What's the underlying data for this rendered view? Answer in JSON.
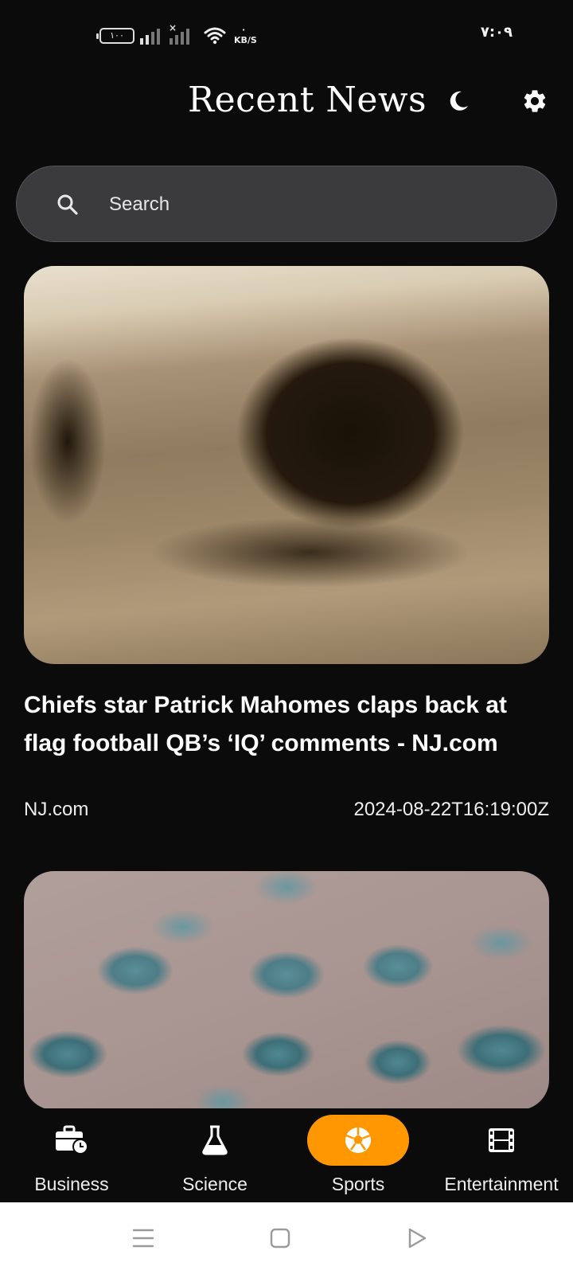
{
  "status_bar": {
    "battery": "۱۰۰",
    "network_speed": "KB/S",
    "time": "۷:۰۹",
    "icons": [
      "battery-icon",
      "signal-icon",
      "signal-no-sim-icon",
      "wifi-icon"
    ]
  },
  "header": {
    "title": "Recent News",
    "icons": [
      "moon-icon",
      "gear-icon"
    ]
  },
  "search": {
    "placeholder": "Search",
    "value": "",
    "icon": "search-icon"
  },
  "articles": [
    {
      "image": "sepia photo of a large tree on a grassy hillside",
      "title": "Chiefs star Patrick Mahomes claps back at flag football QB’s ‘IQ’ comments - NJ.com",
      "source": "NJ.com",
      "published_at": "2024-08-22T16:19:00Z"
    },
    {
      "image": "close-up of blue water droplets on a surface"
    }
  ],
  "bottom_nav": {
    "items": [
      {
        "label": "Business",
        "icon": "briefcase-clock-icon",
        "active": false
      },
      {
        "label": "Science",
        "icon": "flask-icon",
        "active": false
      },
      {
        "label": "Sports",
        "icon": "soccer-ball-icon",
        "active": true
      },
      {
        "label": "Entertainment",
        "icon": "film-icon",
        "active": false
      }
    ],
    "active_color": "#ff9800"
  },
  "system_nav": {
    "icons": [
      "menu-icon",
      "home-icon",
      "back-icon"
    ]
  },
  "colors": {
    "background": "#0b0b0c",
    "search_background": "#3b3b3e",
    "accent": "#ff9800"
  }
}
